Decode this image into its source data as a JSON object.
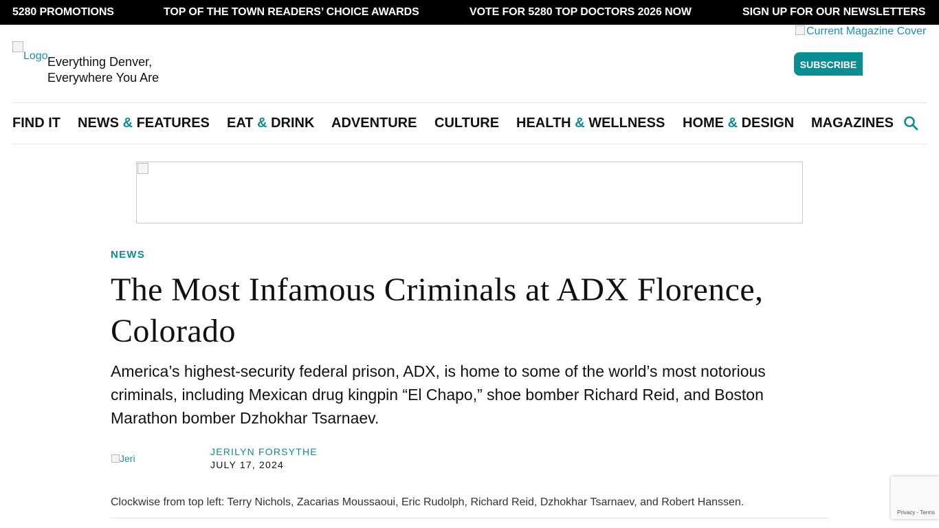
{
  "top_bar": {
    "promos": [
      "5280 PROMOTIONS",
      "TOP OF THE TOWN READERS’ CHOICE AWARDS",
      "VOTE FOR 5280 TOP DOCTORS 2026 NOW",
      "SIGN UP FOR OUR NEWSLETTERS"
    ]
  },
  "header": {
    "logo_alt": "Logo",
    "tagline_line1": "Everything Denver,",
    "tagline_line2": "Everywhere You Are",
    "cover_alt": "Current Magazine Cover",
    "subscribe_label": "SUBSCRIBE"
  },
  "nav": {
    "items": [
      {
        "pre": "FIND IT",
        "amp": "",
        "post": ""
      },
      {
        "pre": "NEWS ",
        "amp": "&",
        "post": " FEATURES"
      },
      {
        "pre": "EAT ",
        "amp": "&",
        "post": " DRINK"
      },
      {
        "pre": "ADVENTURE",
        "amp": "",
        "post": ""
      },
      {
        "pre": "CULTURE",
        "amp": "",
        "post": ""
      },
      {
        "pre": "HEALTH ",
        "amp": "&",
        "post": " WELLNESS"
      },
      {
        "pre": "HOME ",
        "amp": "&",
        "post": " DESIGN"
      },
      {
        "pre": "MAGAZINES",
        "amp": "",
        "post": ""
      }
    ],
    "search_icon": "search-icon"
  },
  "article": {
    "category": "NEWS",
    "headline": "The Most Infamous Criminals at ADX Florence, Colorado",
    "dek": "America’s highest-security federal prison, ADX, is home to some of the world’s most notorious criminals, including Mexican drug kingpin “El Chapo,” shoe bomber Richard Reid, and Boston Marathon bomber Dzhokhar Tsarnaev.",
    "author_img_alt": "Jeri",
    "author": "JERILYN FORSYTHE",
    "date": "JULY 17, 2024",
    "caption": "Clockwise from top left: Terry Nichols, Zacarias Moussaoui, Eric Rudolph, Richard Reid, Dzhokhar Tsarnaev, and Robert Hanssen."
  },
  "recaptcha": {
    "privacy": "Privacy",
    "separator": " - ",
    "terms": "Terms"
  },
  "colors": {
    "accent": "#0b8e93",
    "top_bar_bg": "#000000",
    "link_blue": "#1a8fbf"
  }
}
